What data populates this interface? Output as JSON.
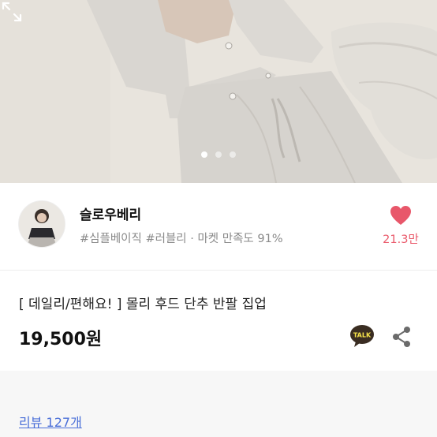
{
  "product_image": {
    "description": "model wearing gray hooded short sleeve zip-up set",
    "slides": 3,
    "active_slide": 0
  },
  "seller": {
    "name": "슬로우베리",
    "tags": "#심플베이직 #러블리 · 마켓 만족도 91%",
    "likes": "21.3만"
  },
  "product": {
    "title": "[ 데일리/편해요! ] 몰리 후드 단추 반팔 집업",
    "price": "19,500원"
  },
  "reviews": {
    "label": "리뷰 127개"
  },
  "icons": {
    "expand": "expand-icon",
    "heart": "heart-icon",
    "talk": "kakao-talk-icon",
    "share": "share-icon"
  },
  "colors": {
    "heart": "#e8576a",
    "likes_text": "#ea5a6b",
    "review_link": "#4a6fd8",
    "talk_bubble": "#3a2d22"
  }
}
